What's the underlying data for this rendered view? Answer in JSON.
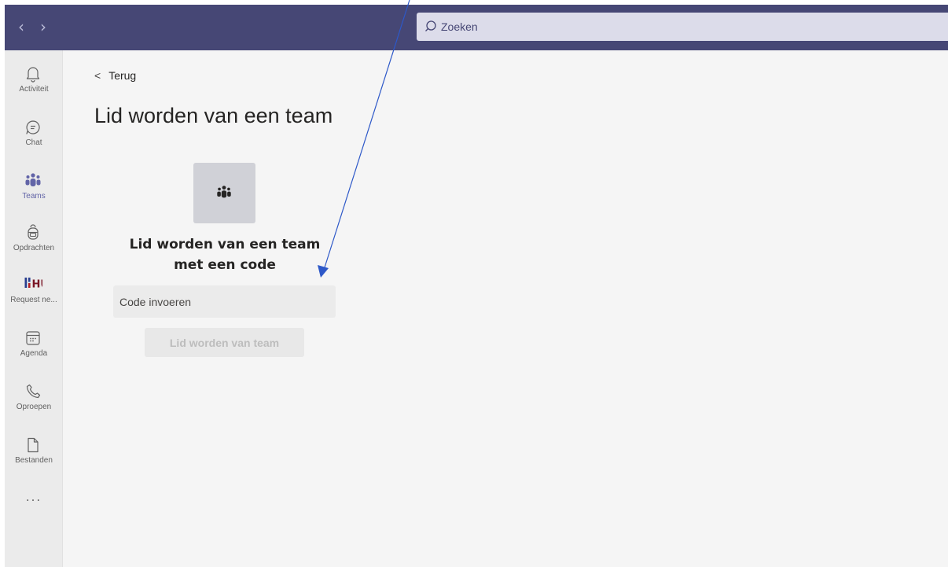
{
  "topbar": {
    "back_arrow": "‹",
    "forward_arrow": "›",
    "search_placeholder": "Zoeken",
    "search_icon": "search-icon"
  },
  "rail": {
    "items": [
      {
        "label": "Activiteit",
        "icon": "bell-icon"
      },
      {
        "label": "Chat",
        "icon": "chat-icon"
      },
      {
        "label": "Teams",
        "icon": "teams-icon",
        "active": true
      },
      {
        "label": "Opdrachten",
        "icon": "backpack-icon"
      },
      {
        "label": "Request ne...",
        "icon": "hu-logo-icon",
        "logo_text": "HU"
      },
      {
        "label": "Agenda",
        "icon": "calendar-icon"
      },
      {
        "label": "Oproepen",
        "icon": "phone-icon"
      },
      {
        "label": "Bestanden",
        "icon": "file-icon"
      }
    ],
    "more": "..."
  },
  "main": {
    "back_label": "Terug",
    "back_chevron": "<",
    "title": "Lid worden van een team",
    "card": {
      "title_line1": "Lid worden van een team",
      "title_line2": "met een code",
      "input_placeholder": "Code invoeren",
      "button_label": "Lid worden van team"
    }
  },
  "colors": {
    "topbar": "#464775",
    "accent": "#6264a7",
    "rail_bg": "#ebebeb",
    "main_bg": "#f5f5f5",
    "annotation_arrow": "#2d58c8"
  }
}
